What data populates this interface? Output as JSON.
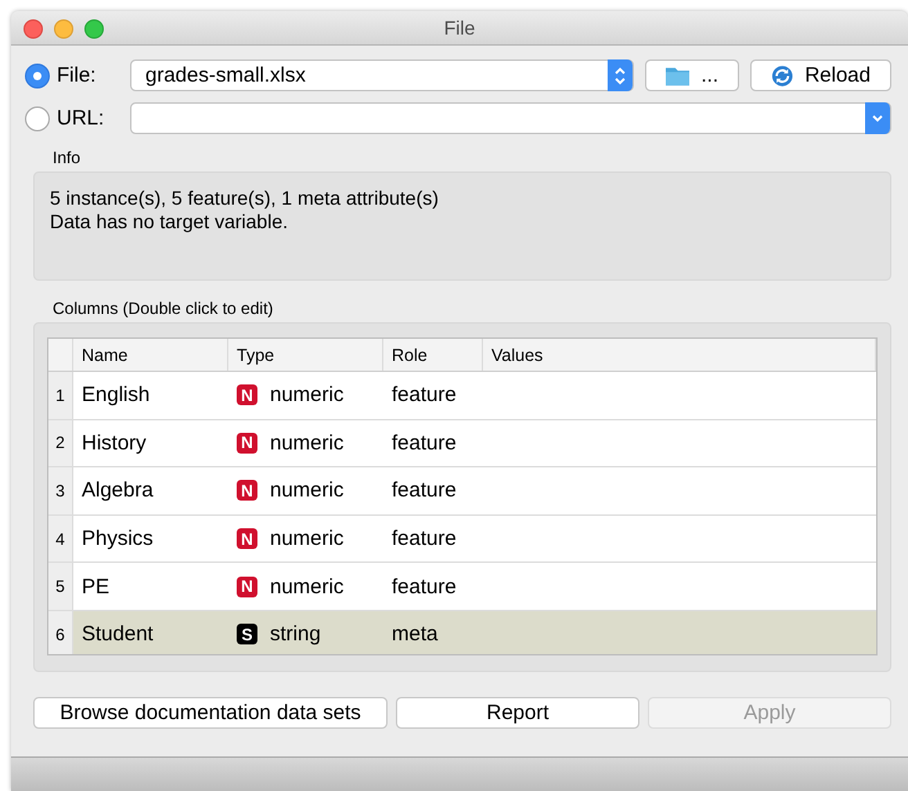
{
  "window": {
    "title": "File"
  },
  "file_source": {
    "label": "File:",
    "selected": true,
    "value": "grades-small.xlsx",
    "browse_label": "...",
    "reload_label": "Reload"
  },
  "url_source": {
    "label": "URL:",
    "selected": false
  },
  "info": {
    "title": "Info",
    "lines": [
      "5 instance(s), 5 feature(s), 1 meta attribute(s)",
      "Data has no target variable."
    ]
  },
  "columns": {
    "title": "Columns (Double click to edit)",
    "headers": [
      "Name",
      "Type",
      "Role",
      "Values"
    ],
    "rows": [
      {
        "index": "1",
        "name": "English",
        "badge": "N",
        "color": "#d0102e",
        "type": "numeric",
        "role": "feature",
        "selected": false
      },
      {
        "index": "2",
        "name": "History",
        "badge": "N",
        "color": "#d0102e",
        "type": "numeric",
        "role": "feature",
        "selected": false
      },
      {
        "index": "3",
        "name": "Algebra",
        "badge": "N",
        "color": "#d0102e",
        "type": "numeric",
        "role": "feature",
        "selected": false
      },
      {
        "index": "4",
        "name": "Physics",
        "badge": "N",
        "color": "#d0102e",
        "type": "numeric",
        "role": "feature",
        "selected": false
      },
      {
        "index": "5",
        "name": "PE",
        "badge": "N",
        "color": "#d0102e",
        "type": "numeric",
        "role": "feature",
        "selected": false
      },
      {
        "index": "6",
        "name": "Student",
        "badge": "S",
        "color": "#000000",
        "type": "string",
        "role": "meta",
        "selected": true
      }
    ]
  },
  "buttons": [
    {
      "label": "Browse documentation data sets",
      "disabled": false
    },
    {
      "label": "Report",
      "disabled": false
    },
    {
      "label": "Apply",
      "disabled": true
    }
  ]
}
